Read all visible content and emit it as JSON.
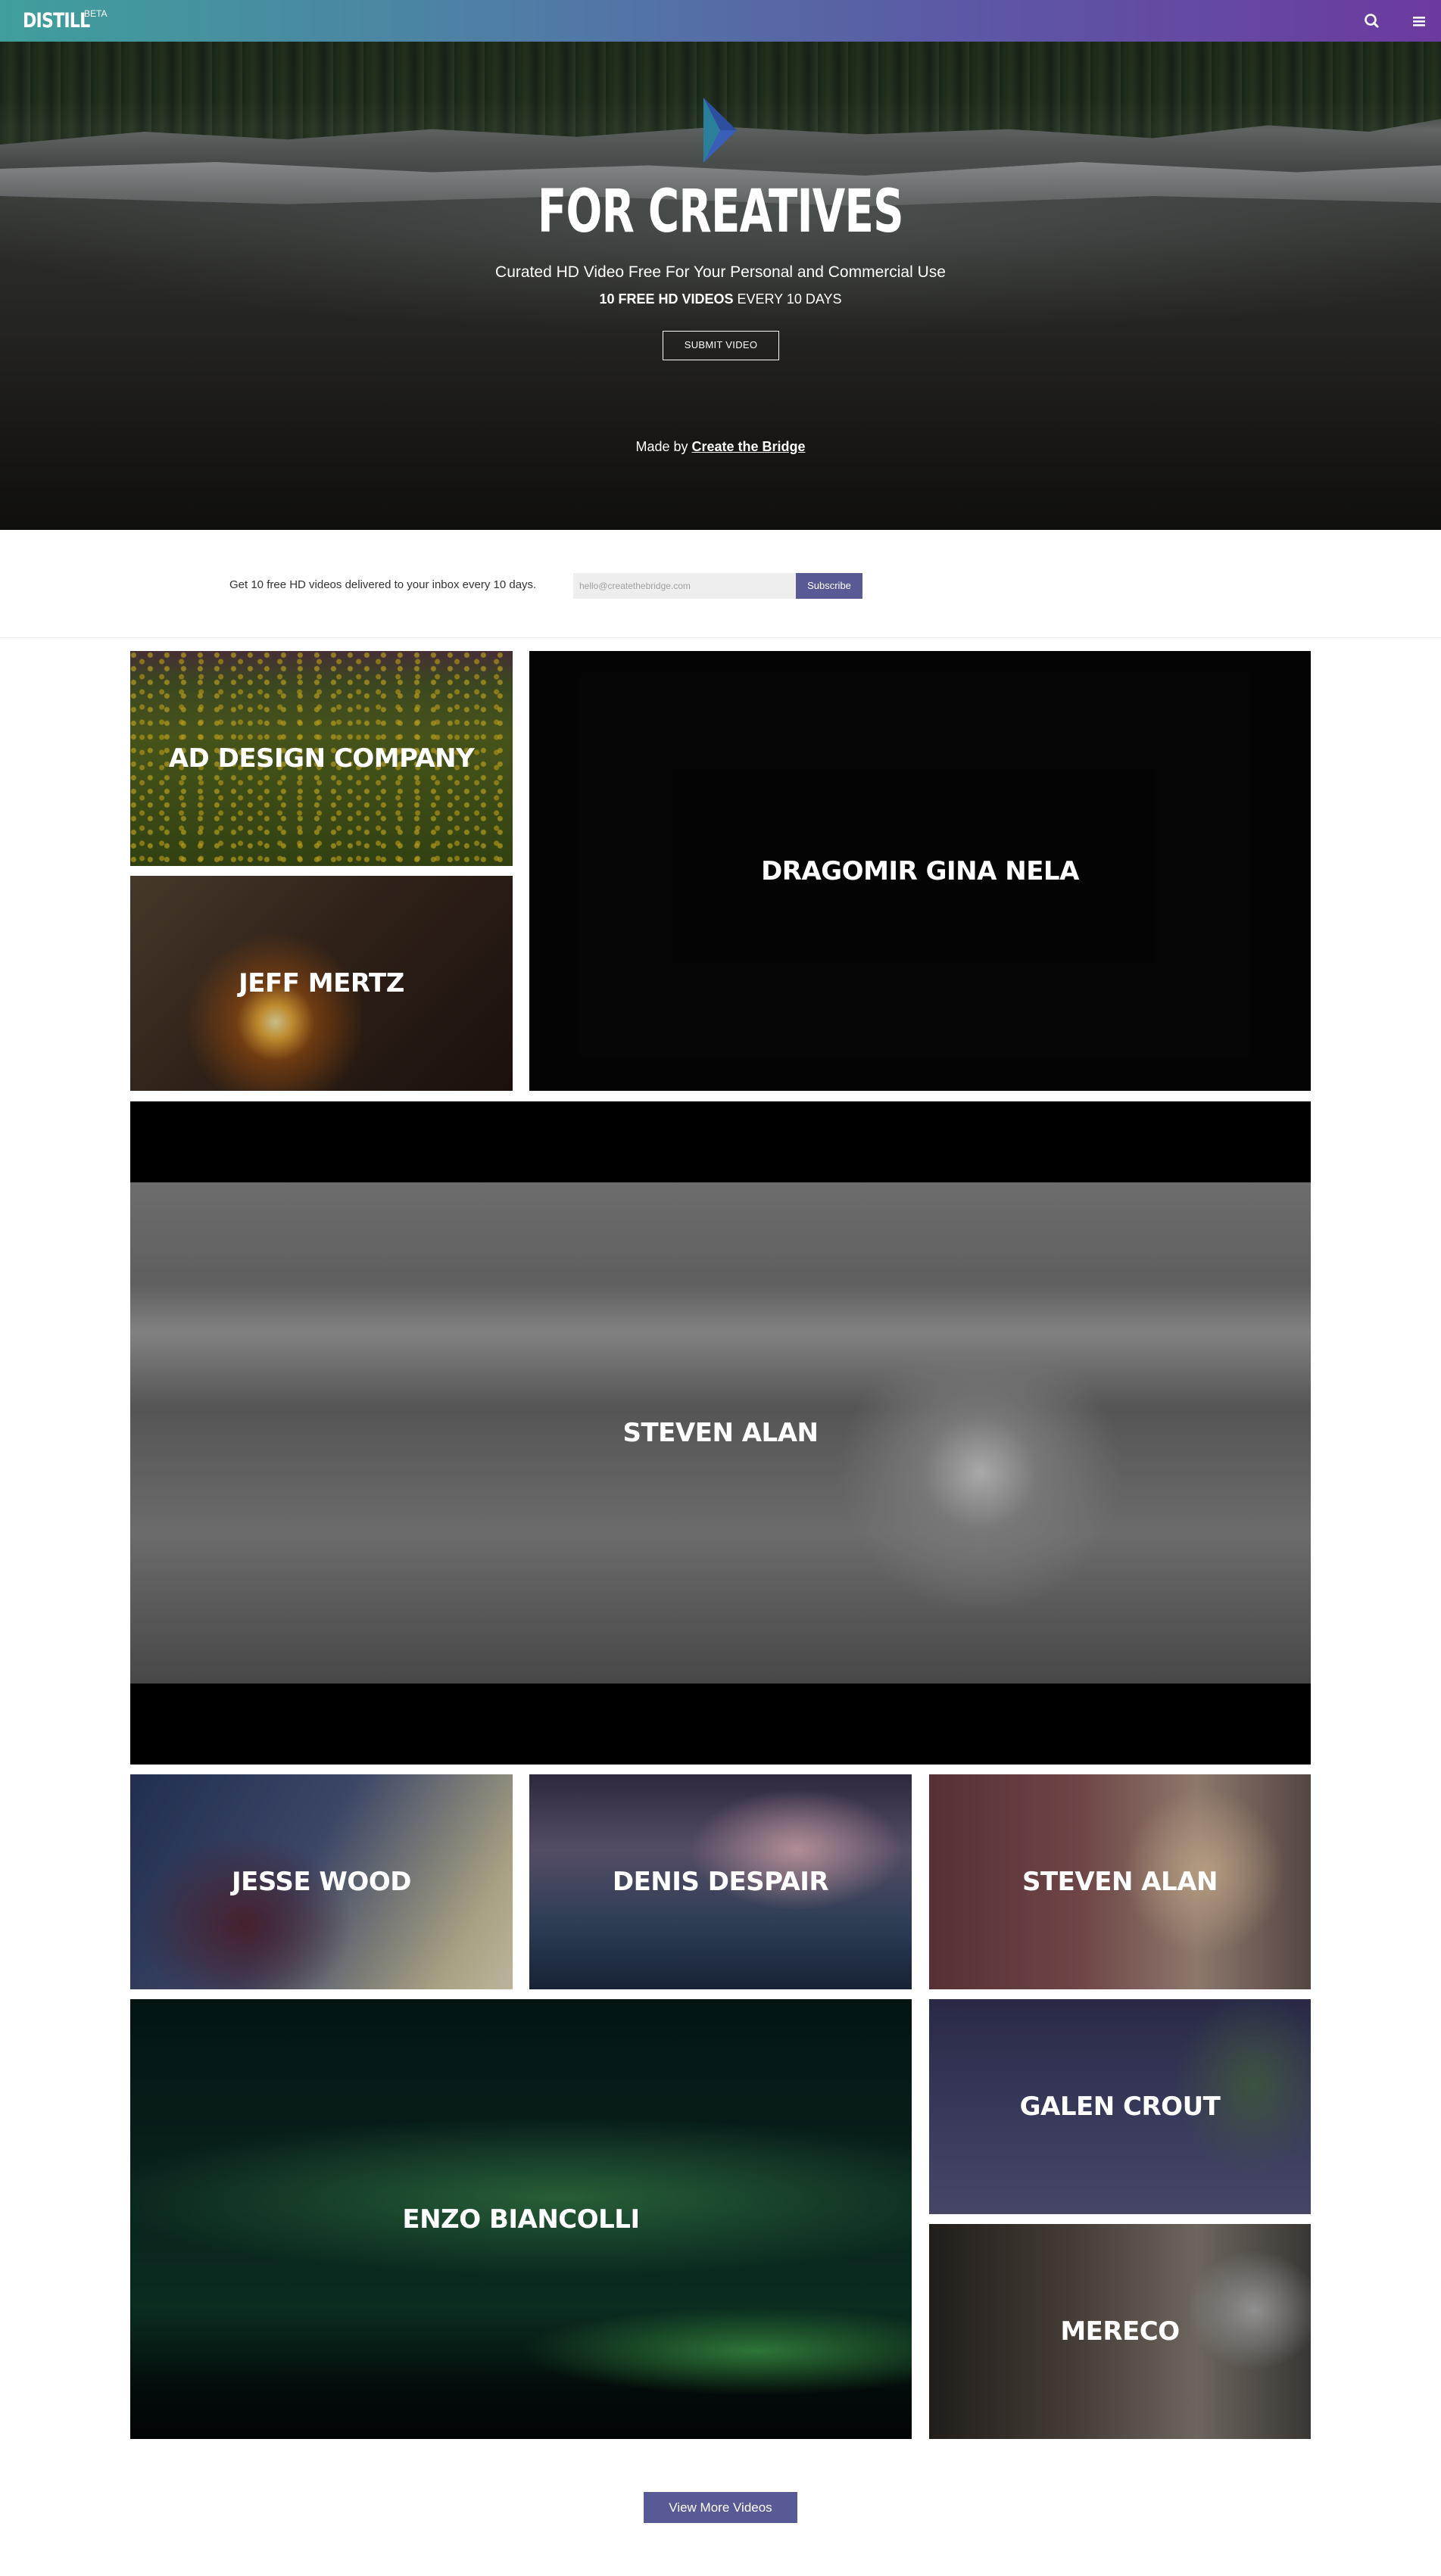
{
  "nav": {
    "logo": "DISTILL",
    "beta": "BETA",
    "icons": [
      "search-icon",
      "menu-icon"
    ]
  },
  "hero": {
    "title": "FOR CREATIVES",
    "subtitle": "Curated HD Video Free For Your Personal and Commercial Use",
    "count_bold": "10 FREE HD VIDEOS",
    "count_rest": " EVERY 10 DAYS",
    "submit_label": "SUBMIT VIDEO",
    "madeby_prefix": "Made by ",
    "madeby_link": "Create the Bridge"
  },
  "subscribe": {
    "text": "Get 10 free HD videos delivered to your inbox every 10 days.",
    "placeholder": "hello@createthebridge.com",
    "button": "Subscribe"
  },
  "tiles": [
    {
      "label": "AD DESIGN COMPANY"
    },
    {
      "label": "JEFF MERTZ"
    },
    {
      "label": "DRAGOMIR GINA NELA"
    },
    {
      "label": "STEVEN ALAN"
    },
    {
      "label": "JESSE WOOD"
    },
    {
      "label": "DENIS DESPAIR"
    },
    {
      "label": "STEVEN ALAN"
    },
    {
      "label": "ENZO BIANCOLLI"
    },
    {
      "label": "GALEN CROUT"
    },
    {
      "label": "MERECO"
    }
  ],
  "view_more": "View More Videos",
  "colors": {
    "nav_gradient_start": "#3f9f9b",
    "nav_gradient_end": "#6c3a9f",
    "button_accent": "#585a96"
  }
}
